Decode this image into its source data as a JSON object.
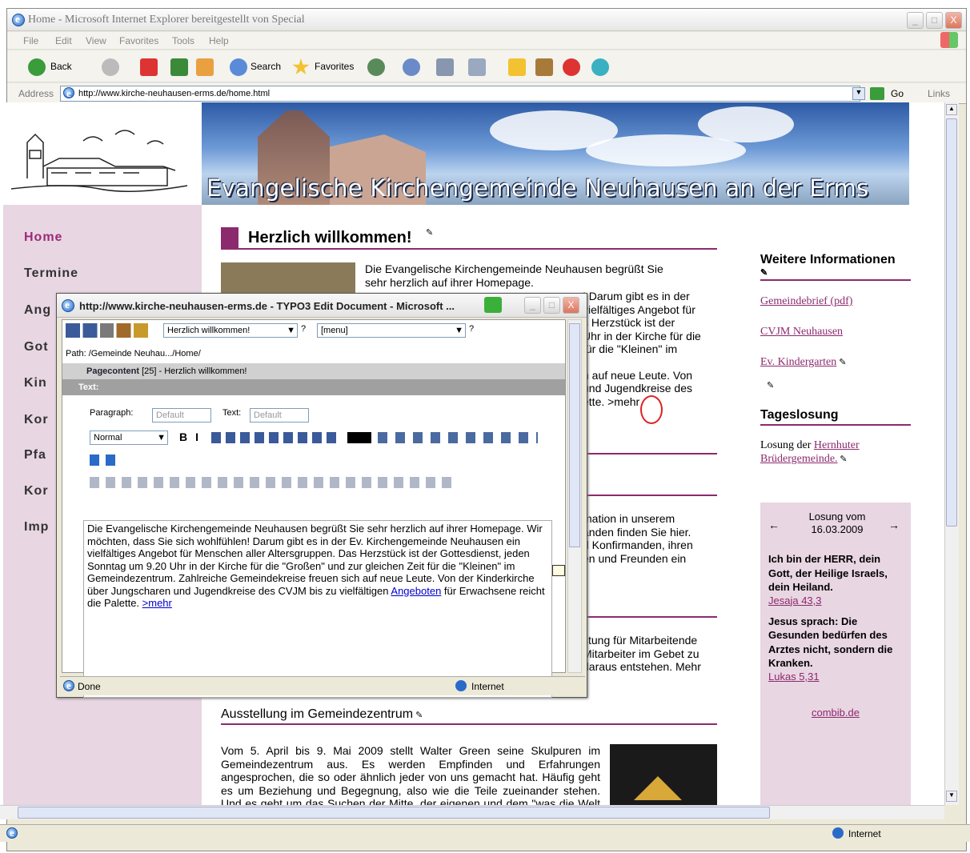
{
  "window": {
    "title": "Home - Microsoft Internet Explorer bereitgestellt von Special",
    "controls": [
      "_",
      "□",
      "X"
    ]
  },
  "menu": [
    "File",
    "Edit",
    "View",
    "Favorites",
    "Tools",
    "Help"
  ],
  "toolbar": {
    "back": "Back",
    "search": "Search",
    "favorites": "Favorites"
  },
  "address": {
    "label": "Address",
    "url": "http://www.kirche-neuhausen-erms.de/home.html",
    "go": "Go",
    "links": "Links"
  },
  "banner": {
    "title": "Evangelische Kirchengemeinde Neuhausen an der Erms"
  },
  "nav": [
    "Home",
    "Termine",
    "Ang",
    "Got",
    "Kin",
    "Kor",
    "Pfa",
    "Kor",
    "Imp"
  ],
  "main": {
    "heading": "Herzlich willkommen!",
    "welcome_lines": [
      "Die Evangelische Kirchengemeinde Neuhausen begrüßt Sie",
      "sehr herzlich auf ihrer Homepage.",
      "! Darum gibt es in der",
      "vielfältiges Angebot für",
      "s Herzstück ist der",
      "Uhr in der Kirche für die",
      "für die \"Kleinen\" im",
      "h auf neue Leute. Von",
      "und Jugendkreise des",
      "ette. >mehr"
    ],
    "info_lines": [
      "mation in unserem",
      "anden finden Sie hier.",
      "d Konfirmanden, ihren",
      "en und Freunden ein"
    ],
    "staff_lines": [
      "stung für Mitarbeitende",
      "Mitarbeiter im Gebet zu",
      "daraus entstehen. Mehr"
    ],
    "exhibition_heading": "Ausstellung im Gemeindezentrum",
    "exhibition_text": "Vom 5. April bis 9. Mai 2009 stellt Walter Green seine Skulpuren im Gemeindezentrum aus. Es werden Empfinden und Erfahrungen angesprochen, die so oder ähnlich jeder von uns gemacht hat. Häufig geht es um Beziehung und Begegnung, also wie die Teile zueinander stehen. Und es geht um das Suchen der Mitte, der eigenen und dem \"was die Welt im Innersten zusammenhält\". Bei"
  },
  "right": {
    "info_heading": "Weitere Informationen",
    "links": [
      "Gemeindebrief (pdf)",
      "CVJM Neuhausen",
      "Ev. Kindergarten"
    ],
    "losung_heading": "Tageslosung",
    "losung_label": "Losung der",
    "losung_link": "Hernhuter Brüdergemeinde.",
    "losung_date_label": "Losung vom",
    "losung_date": "16.03.2009",
    "verse1": "Ich bin der HERR, dein Gott, der Heilige Israels, dein Heiland.",
    "ref1": "Jesaja 43,3",
    "verse2": "Jesus sprach: Die Gesunden bedürfen des Arztes nicht, sondern die Kranken.",
    "ref2": "Lukas 5,31",
    "credit": "combib.de"
  },
  "popup": {
    "title": "http://www.kirche-neuhausen-erms.de - TYPO3 Edit Document - Microsoft ...",
    "select_page": "Herzlich willkommen!",
    "select_menu": "[menu]",
    "path": "Path: /Gemeinde Neuhau.../Home/",
    "record": "Pagecontent",
    "record_suffix": " [25] - Herzlich willkommen!",
    "text_label": "Text:",
    "paragraph_label": "Paragraph:",
    "paragraph_value": "Default",
    "text_style_label": "Text:",
    "text_style_value": "Default",
    "block_format": "Normal",
    "rte_text": "Die Evangelische Kirchengemeinde Neuhausen begrüßt Sie sehr herzlich auf ihrer Homepage. Wir möchten, dass Sie sich wohlfühlen! Darum gibt es in der Ev. Kirchengemeinde Neuhausen ein vielfältiges Angebot für Menschen aller Altersgruppen. Das Herzstück ist der Gottesdienst, jeden Sonntag um 9.20 Uhr in der Kirche für die \"Großen\" und zur gleichen Zeit für die \"Kleinen\" im Gemeindezentrum. Zahlreiche Gemeindekreise freuen sich auf neue Leute. Von der Kinderkirche über Jungscharen und Jugendkreise des CVJM bis zu vielfältigen",
    "rte_link": "Angeboten",
    "rte_after": " für Erwachsene reicht die Palette. ",
    "rte_more": ">mehr",
    "status_done": "Done",
    "status_zone": "Internet"
  },
  "statusbar": {
    "zone": "Internet"
  }
}
